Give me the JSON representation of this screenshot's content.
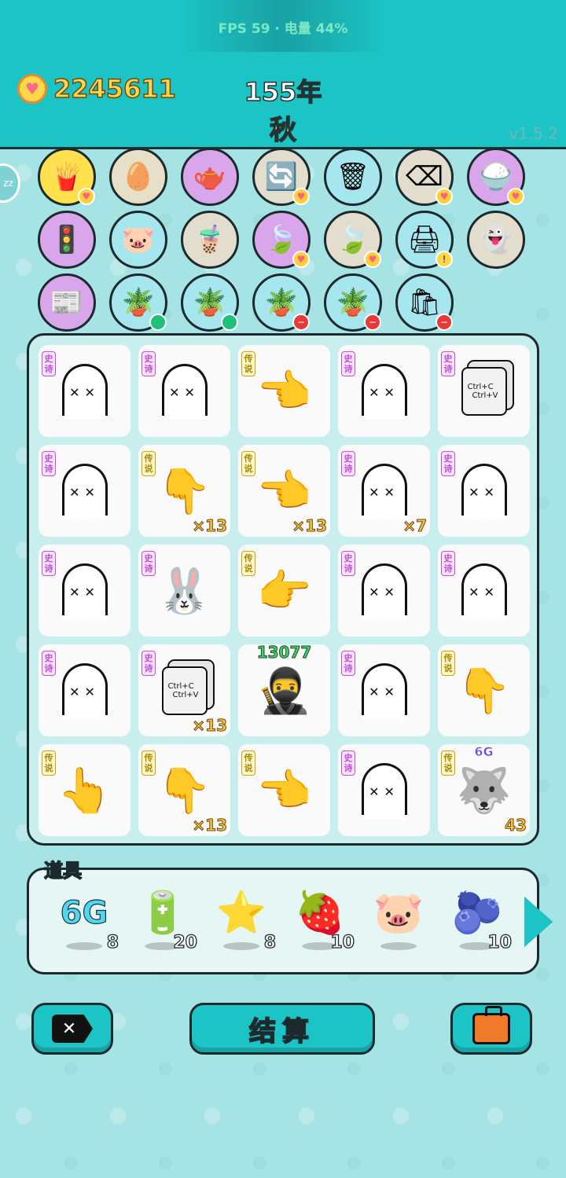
{
  "status_bar": {
    "fps_text": "FPS 59 · 电量 44%"
  },
  "header": {
    "coins": "2245611",
    "year": "155年",
    "season": "秋",
    "version": "v1.5.2",
    "sleep_label": "zz"
  },
  "items": {
    "row1": [
      {
        "icon": "fries-icon",
        "glyph": "🍟",
        "bg": "#ffe14d",
        "badge": "heart"
      },
      {
        "icon": "egg-tray-icon",
        "glyph": "🥚",
        "bg": "#e8dfc8",
        "badge": ""
      },
      {
        "icon": "gravy-boat-icon",
        "glyph": "🫖",
        "bg": "#d9a6ec",
        "badge": ""
      },
      {
        "icon": "refresh-icon",
        "glyph": "🔄",
        "bg": "#e3ddcd",
        "badge": "heart"
      },
      {
        "icon": "trash-bag-icon",
        "glyph": "🗑",
        "bg": "#a6e6ee",
        "badge": ""
      },
      {
        "icon": "delete-key-icon",
        "glyph": "⌫",
        "bg": "#e3ddcd",
        "badge": "heart"
      },
      {
        "icon": "rice-bowl-icon",
        "glyph": "🍚",
        "bg": "#d9a6ec",
        "badge": "heart"
      }
    ],
    "row2": [
      {
        "icon": "traffic-light-icon",
        "glyph": "🚦",
        "bg": "#d9a6ec",
        "badge": ""
      },
      {
        "icon": "piggy-bank-icon",
        "glyph": "🐷",
        "bg": "#a6e6ee",
        "badge": ""
      },
      {
        "icon": "bubble-tea-icon",
        "glyph": "🧋",
        "bg": "#e3ddcd",
        "badge": ""
      },
      {
        "icon": "leaf-icon",
        "glyph": "🍃",
        "bg": "#d9a6ec",
        "badge": "heart"
      },
      {
        "icon": "leaf-icon",
        "glyph": "🍃",
        "bg": "#e3ddcd",
        "badge": "heart"
      },
      {
        "icon": "printer-icon",
        "glyph": "🖨",
        "bg": "#a6e6ee",
        "badge": "warn"
      },
      {
        "icon": "ghost-wink-icon",
        "glyph": "👻",
        "bg": "#e3ddcd",
        "badge": ""
      }
    ],
    "row3": [
      {
        "icon": "time-magazine-icon",
        "glyph": "📰",
        "bg": "#d9a6ec",
        "badge": ""
      },
      {
        "icon": "potted-flower-icon",
        "glyph": "🪴",
        "bg": "#a6e6ee",
        "badge": "green"
      },
      {
        "icon": "potted-flower-icon",
        "glyph": "🪴",
        "bg": "#a6e6ee",
        "badge": "green"
      },
      {
        "icon": "potted-flower-icon",
        "glyph": "🪴",
        "bg": "#a6e6ee",
        "badge": "red"
      },
      {
        "icon": "potted-flower-icon",
        "glyph": "🪴",
        "bg": "#a6e6ee",
        "badge": "red"
      },
      {
        "icon": "trash-bag-icon",
        "glyph": "🛍",
        "bg": "#a6e6ee",
        "badge": "red"
      }
    ]
  },
  "tags": {
    "epic": "史诗",
    "legend": "传说"
  },
  "board": [
    {
      "type": "ghost",
      "tag": "epic",
      "count": ""
    },
    {
      "type": "ghost",
      "tag": "epic",
      "count": ""
    },
    {
      "type": "hand-point-down-left",
      "glyph": "👈",
      "tag": "legend",
      "count": ""
    },
    {
      "type": "ghost",
      "tag": "epic",
      "count": ""
    },
    {
      "type": "copy-paste",
      "tag": "epic",
      "count": ""
    },
    {
      "type": "ghost",
      "tag": "epic",
      "count": ""
    },
    {
      "type": "hand-point-down-left",
      "glyph": "👇",
      "tag": "legend",
      "count": "×13"
    },
    {
      "type": "hand-point-left",
      "glyph": "👈",
      "tag": "legend",
      "count": "×13"
    },
    {
      "type": "ghost",
      "tag": "epic",
      "count": "×7"
    },
    {
      "type": "ghost",
      "tag": "epic",
      "count": ""
    },
    {
      "type": "ghost",
      "tag": "epic",
      "count": ""
    },
    {
      "type": "bunny-bag",
      "glyph": "🐰",
      "tag": "epic",
      "count": ""
    },
    {
      "type": "hand-point-down-right",
      "glyph": "👉",
      "tag": "legend",
      "count": ""
    },
    {
      "type": "ghost",
      "tag": "epic",
      "count": ""
    },
    {
      "type": "ghost",
      "tag": "epic",
      "count": ""
    },
    {
      "type": "ghost",
      "tag": "epic",
      "count": ""
    },
    {
      "type": "copy-paste",
      "tag": "epic",
      "count": "×13"
    },
    {
      "type": "thief",
      "glyph": "🥷",
      "tag": "",
      "count": "",
      "top_number": "13077"
    },
    {
      "type": "ghost",
      "tag": "epic",
      "count": ""
    },
    {
      "type": "hand-point-down",
      "glyph": "👇",
      "tag": "legend",
      "count": ""
    },
    {
      "type": "hand-point-up-left",
      "glyph": "👆",
      "tag": "legend",
      "count": ""
    },
    {
      "type": "hand-point-down",
      "glyph": "👇",
      "tag": "legend",
      "count": "×13"
    },
    {
      "type": "hand-point-left",
      "glyph": "👈",
      "tag": "legend",
      "count": ""
    },
    {
      "type": "ghost",
      "tag": "epic",
      "count": ""
    },
    {
      "type": "husky-king",
      "glyph": "🐺",
      "tag": "legend",
      "count": "43",
      "top_label": "6G"
    }
  ],
  "copy_card": {
    "line1": "Ctrl+C",
    "line2": "Ctrl+V"
  },
  "props": {
    "title": "道具",
    "list": [
      {
        "icon": "6g-icon",
        "label": "6G",
        "qty": "8"
      },
      {
        "icon": "battery-icon",
        "glyph": "🔋",
        "qty": "20"
      },
      {
        "icon": "star-icon",
        "glyph": "⭐",
        "qty": "8"
      },
      {
        "icon": "bayberry-icon",
        "glyph": "🍓",
        "qty": "10"
      },
      {
        "icon": "piggy-bank-icon",
        "glyph": "🐷",
        "qty": ""
      },
      {
        "icon": "blueberry-icon",
        "glyph": "🫐",
        "qty": "10"
      }
    ]
  },
  "buttons": {
    "settle": "结算"
  }
}
